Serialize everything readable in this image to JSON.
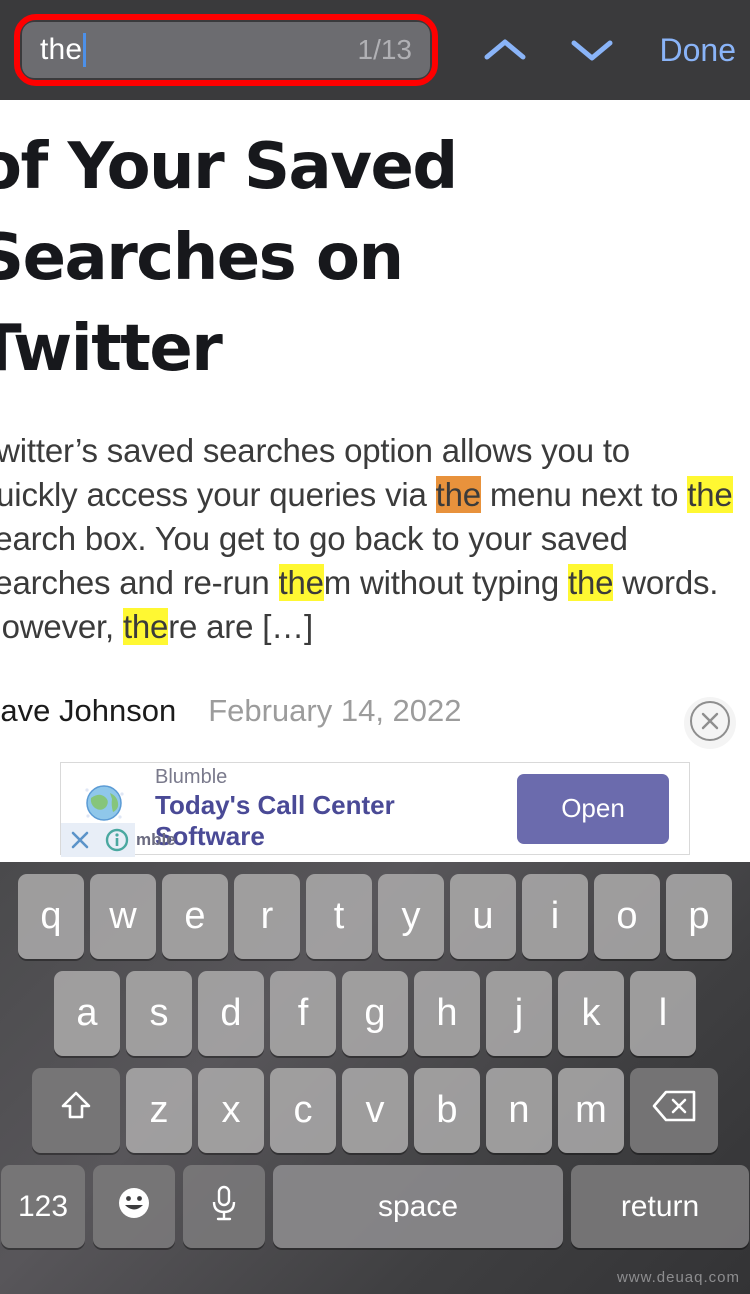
{
  "findbar": {
    "query": "the",
    "match_counter": "1/13",
    "prev_icon": "chevron-up-icon",
    "next_icon": "chevron-down-icon",
    "done_label": "Done",
    "accent_color": "#8ab4f8",
    "bar_background": "#3a3a3c",
    "field_background": "#6c6c70",
    "annotation_color": "#fe0000"
  },
  "article": {
    "headline": "of Your Saved\nSearches on\nTwitter",
    "lede_parts": [
      {
        "text": "Twitter’s saved searches option allows you to quickly access your queries via ",
        "highlight": "none"
      },
      {
        "text": "the",
        "highlight": "active"
      },
      {
        "text": " menu next to ",
        "highlight": "none"
      },
      {
        "text": "the",
        "highlight": "match"
      },
      {
        "text": " search box. You get to go back to your saved searches and re-run ",
        "highlight": "none"
      },
      {
        "text": "the",
        "highlight": "match"
      },
      {
        "text": "m without typing ",
        "highlight": "none"
      },
      {
        "text": "the",
        "highlight": "match"
      },
      {
        "text": " words. However, ",
        "highlight": "none"
      },
      {
        "text": "the",
        "highlight": "match"
      },
      {
        "text": "re are […]",
        "highlight": "none"
      }
    ],
    "author": "Dave Johnson",
    "date": "February 14, 2022",
    "highlight_color": "#fff832",
    "active_highlight_color": "#e8923c",
    "close_icon": "close-circle-icon"
  },
  "ad": {
    "advertiser": "Blumble",
    "title": "Today's Call Center\nSoftware",
    "cta_label": "Open",
    "cta_color": "#6b6bad",
    "icon": "globe-icon",
    "close_icon": "ad-close-icon",
    "info_icon": "ad-info-icon",
    "brand_mini": "mble"
  },
  "keyboard": {
    "row1": [
      "q",
      "w",
      "e",
      "r",
      "t",
      "y",
      "u",
      "i",
      "o",
      "p"
    ],
    "row2": [
      "a",
      "s",
      "d",
      "f",
      "g",
      "h",
      "j",
      "k",
      "l"
    ],
    "row3": [
      "z",
      "x",
      "c",
      "v",
      "b",
      "n",
      "m"
    ],
    "shift_icon": "shift-arrow-icon",
    "backspace_icon": "backspace-icon",
    "numeric_label": "123",
    "emoji_icon": "emoji-smiley-icon",
    "mic_icon": "microphone-icon",
    "space_label": "space",
    "return_label": "return"
  },
  "watermark": "www.deuaq.com"
}
